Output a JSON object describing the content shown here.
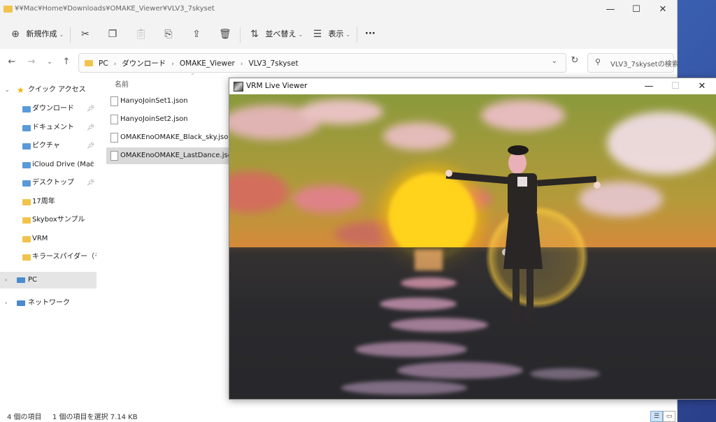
{
  "explorer": {
    "title_path": "¥¥Mac¥Home¥Downloads¥OMAKE_Viewer¥VLV3_7skyset",
    "window_controls": {
      "minimize": "—",
      "maximize": "☐",
      "close": "✕"
    },
    "toolbar": {
      "new_label": "新規作成",
      "sort_label": "並べ替え",
      "view_label": "表示",
      "more_label": "···"
    },
    "breadcrumbs": [
      "PC",
      "ダウンロード",
      "OMAKE_Viewer",
      "VLV3_7skyset"
    ],
    "search_placeholder": "VLV3_7skysetの検索",
    "nav": {
      "quick_access": "クイック アクセス",
      "items": [
        {
          "label": "ダウンロード",
          "pinned": true
        },
        {
          "label": "ドキュメント",
          "pinned": true
        },
        {
          "label": "ピクチャ",
          "pinned": true
        },
        {
          "label": "iCloud Drive (Mac",
          "pinned": true
        },
        {
          "label": "デスクトップ",
          "pinned": true
        },
        {
          "label": "17周年",
          "pinned": false
        },
        {
          "label": "Skyboxサンプル",
          "pinned": false
        },
        {
          "label": "VRM",
          "pinned": false
        },
        {
          "label": "キラースパイダー（モーシ",
          "pinned": false
        }
      ],
      "pc": "PC",
      "network": "ネットワーク"
    },
    "list": {
      "column_name": "名前",
      "files": [
        {
          "name": "HanyoJoinSet1.json",
          "selected": false
        },
        {
          "name": "HanyoJoinSet2.json",
          "selected": false
        },
        {
          "name": "OMAKEnoOMAKE_Black_sky.json",
          "selected": false
        },
        {
          "name": "OMAKEnoOMAKE_LastDance.json",
          "selected": true
        }
      ]
    },
    "status": {
      "count": "4 個の項目",
      "selection": "1 個の項目を選択  7.14 KB"
    }
  },
  "viewer": {
    "title": "VRM Live Viewer",
    "controls": {
      "minimize": "—",
      "maximize": "☐",
      "close": "✕"
    }
  },
  "colors": {
    "folder": "#f0c44c",
    "selected_row": "#d9d9d9",
    "nav_selected": "#e5e5e5",
    "sun": "#ffd21a"
  }
}
